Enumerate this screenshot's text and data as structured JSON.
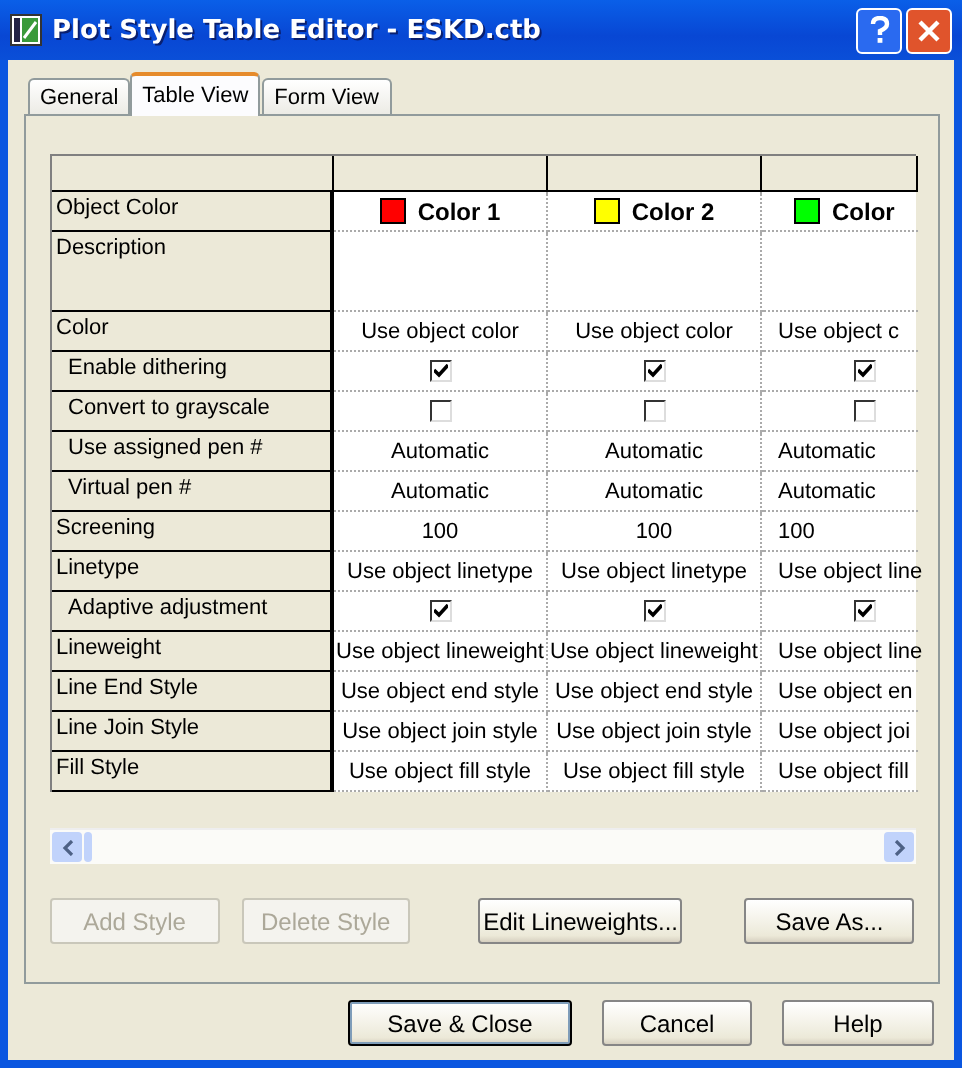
{
  "window": {
    "title": "Plot Style Table Editor - ESKD.ctb"
  },
  "tabs": [
    {
      "label": "General",
      "selected": false
    },
    {
      "label": "Table View",
      "selected": true
    },
    {
      "label": "Form View",
      "selected": false
    }
  ],
  "table": {
    "label_column": "Object Color",
    "columns": [
      {
        "name": "Color 1",
        "color": "#ff0000"
      },
      {
        "name": "Color 2",
        "color": "#ffff00"
      },
      {
        "name": "Color",
        "color": "#00ff00"
      }
    ],
    "rows": [
      {
        "label": "Description",
        "kind": "blank"
      },
      {
        "label": "Color",
        "kind": "text",
        "cells": [
          "Use object color",
          "Use object color",
          "Use object c"
        ],
        "children": [
          {
            "label": "Enable dithering",
            "kind": "check",
            "cells": [
              {
                "checked": true
              },
              {
                "checked": true
              },
              {
                "checked": true
              }
            ]
          },
          {
            "label": "Convert to grayscale",
            "kind": "check",
            "cells": [
              {
                "checked": false
              },
              {
                "checked": false
              },
              {
                "checked": false
              }
            ]
          },
          {
            "label": "Use assigned pen #",
            "kind": "text",
            "cells": [
              "Automatic",
              "Automatic",
              "Automatic"
            ]
          },
          {
            "label": "Virtual pen #",
            "kind": "text",
            "cells": [
              "Automatic",
              "Automatic",
              "Automatic"
            ]
          }
        ]
      },
      {
        "label": "Screening",
        "kind": "text",
        "cells": [
          "100",
          "100",
          "100"
        ]
      },
      {
        "label": "Linetype",
        "kind": "text",
        "cells": [
          "Use object linetype",
          "Use object linetype",
          "Use object line"
        ],
        "children": [
          {
            "label": "Adaptive adjustment",
            "kind": "check",
            "cells": [
              {
                "checked": true
              },
              {
                "checked": true
              },
              {
                "checked": true
              }
            ]
          }
        ]
      },
      {
        "label": "Lineweight",
        "kind": "text",
        "cells": [
          "Use object lineweight",
          "Use object lineweight",
          "Use object line"
        ]
      },
      {
        "label": "Line End Style",
        "kind": "text",
        "cells": [
          "Use object end style",
          "Use object end style",
          "Use object en"
        ]
      },
      {
        "label": "Line Join Style",
        "kind": "text",
        "cells": [
          "Use object join style",
          "Use object join style",
          "Use object joi"
        ]
      },
      {
        "label": "Fill Style",
        "kind": "text",
        "cells": [
          "Use object fill style",
          "Use object fill style",
          "Use object fill"
        ]
      }
    ]
  },
  "panel_buttons": [
    {
      "label": "Add Style",
      "disabled": true
    },
    {
      "label": "Delete Style",
      "disabled": true
    },
    {
      "label": "Edit Lineweights...",
      "disabled": false
    },
    {
      "label": "Save As...",
      "disabled": false
    }
  ],
  "dialog_buttons": [
    {
      "label": "Save & Close",
      "default": true
    },
    {
      "label": "Cancel",
      "default": false
    },
    {
      "label": "Help",
      "default": false
    }
  ]
}
